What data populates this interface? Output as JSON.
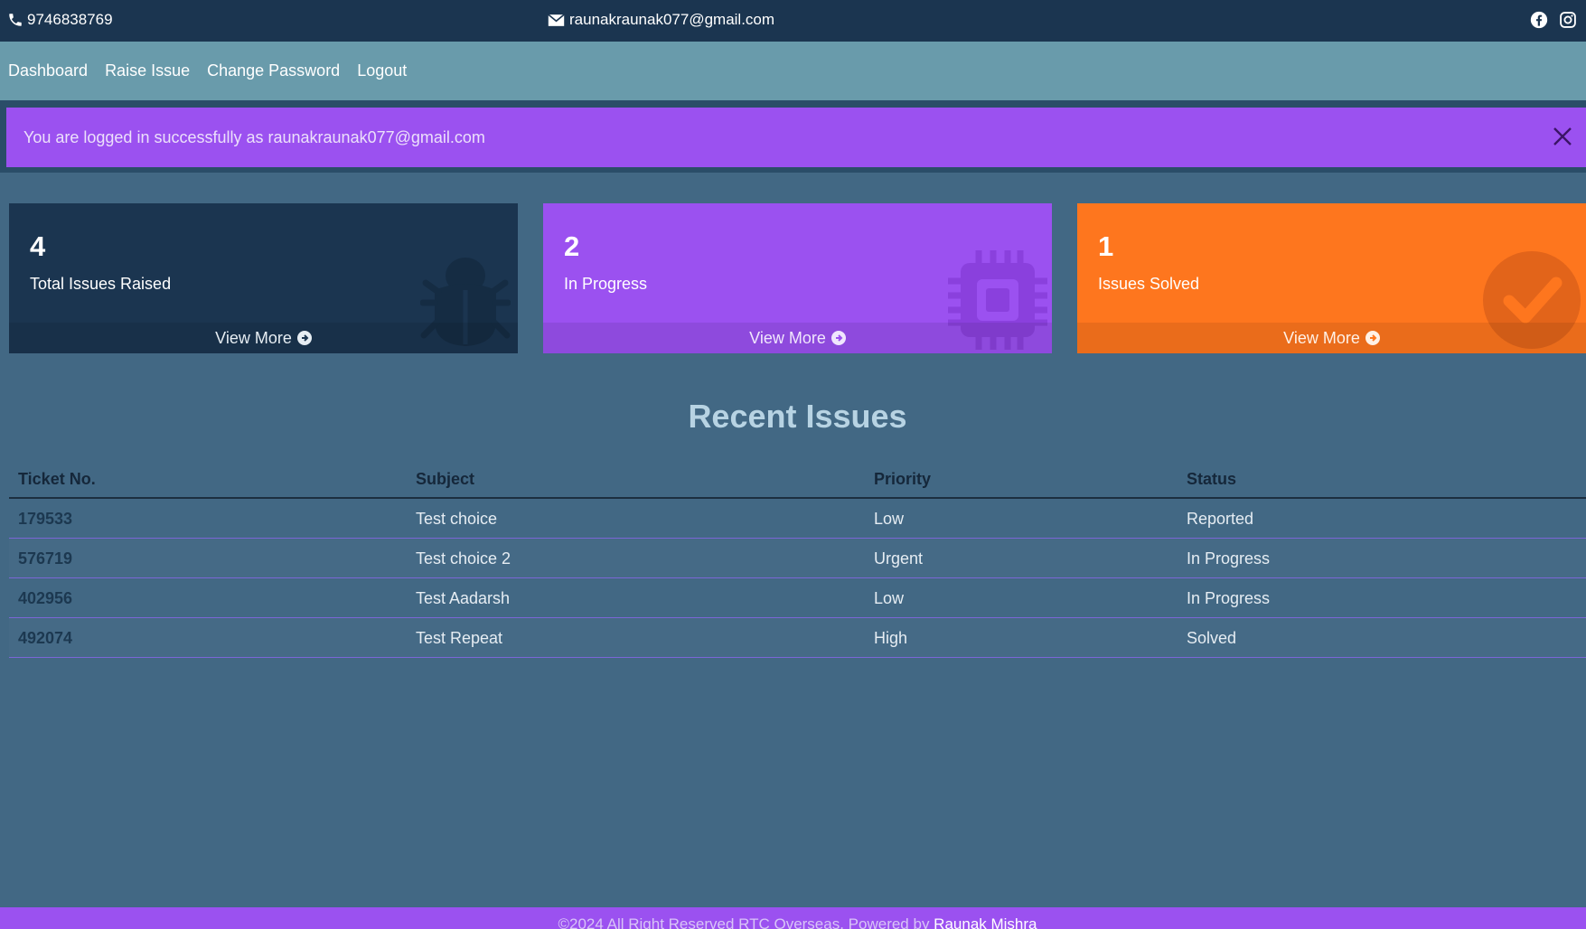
{
  "topbar": {
    "phone": "9746838769",
    "email": "raunakraunak077@gmail.com",
    "social": [
      "facebook-icon",
      "instagram-icon"
    ]
  },
  "nav": {
    "items": [
      {
        "label": "Dashboard"
      },
      {
        "label": "Raise Issue"
      },
      {
        "label": "Change Password"
      },
      {
        "label": "Logout"
      }
    ]
  },
  "alert": {
    "message": "You are logged in successfully as raunakraunak077@gmail.com"
  },
  "cards": [
    {
      "count": "4",
      "label": "Total Issues Raised",
      "more": "View More",
      "icon": "bug-icon",
      "color": "#1b3550"
    },
    {
      "count": "2",
      "label": "In Progress",
      "more": "View More",
      "icon": "chip-icon",
      "color": "#9b51f0"
    },
    {
      "count": "1",
      "label": "Issues Solved",
      "more": "View More",
      "icon": "check-circle-icon",
      "color": "#fe761e"
    }
  ],
  "recent": {
    "title": "Recent Issues",
    "headers": [
      "Ticket No.",
      "Subject",
      "Priority",
      "Status"
    ],
    "rows": [
      [
        "179533",
        "Test choice",
        "Low",
        "Reported"
      ],
      [
        "576719",
        "Test choice 2",
        "Urgent",
        "In Progress"
      ],
      [
        "402956",
        "Test Aadarsh",
        "Low",
        "In Progress"
      ],
      [
        "492074",
        "Test Repeat",
        "High",
        "Solved"
      ]
    ]
  },
  "footer": {
    "text": "©2024 All Right Reserved RTC Overseas. Powered by ",
    "author": "Raunak Mishra"
  }
}
